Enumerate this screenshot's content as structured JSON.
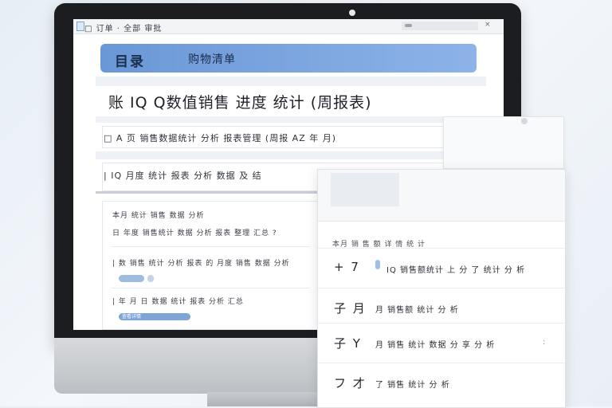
{
  "window": {
    "title": "□ 订单 · 全部 审批",
    "close_glyph": "×"
  },
  "banner": {
    "title": "目录",
    "subtitle": "购物清单"
  },
  "heading": "账 IQ Q数值销售 进度 统计 (周报表)",
  "rows": [
    "□ A 页  销售数据统计 分析 报表管理 (周报 AZ 年 月)",
    "| IQ 月度 统计 报表 分析 数据 及 结"
  ],
  "list": {
    "header": "本月 统计 销售 数据 分析",
    "items": [
      "日 年度 销售统计 数据 分析 报表 整理 汇总 ?",
      "| 数 销售 统计 分析 报表 的 月度 销售 数据 分析",
      "| 年 月 日 数据 统计 报表 分析 汇总"
    ],
    "chip_label": "查看详情"
  },
  "panel": {
    "caption": "本月 销 售 额 详 情 统 计",
    "rows": [
      {
        "symbol": "+ 7",
        "text": "IQ 销售额统计 上 分 了 统计 分 析"
      },
      {
        "symbol": "子 月",
        "text": "月 销售额 统计 分 析"
      },
      {
        "symbol": "子 Y",
        "text": "月 销售 统计 数据 分 享 分 析",
        "more": ":"
      },
      {
        "symbol": "フ 才",
        "text": "了 销售 统计 分 析"
      }
    ]
  }
}
